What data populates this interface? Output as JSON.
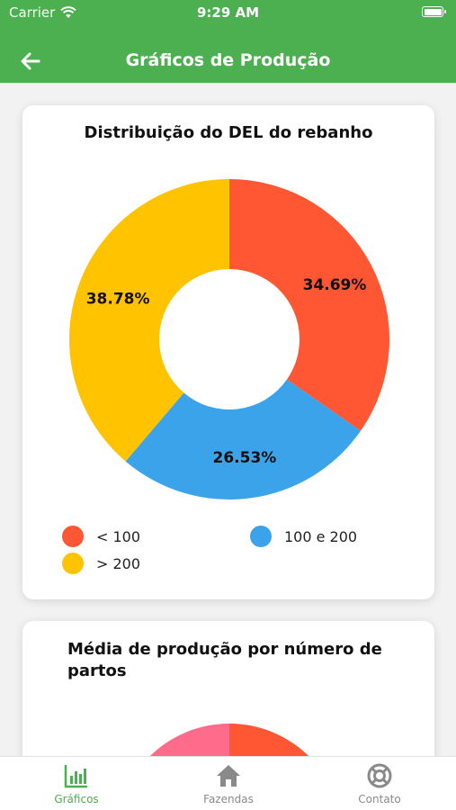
{
  "status_bar": {
    "carrier": "Carrier",
    "time": "9:29 AM"
  },
  "header": {
    "title": "Gráficos de Produção"
  },
  "cards": [
    {
      "title": "Distribuição do DEL do rebanho",
      "chart_data": {
        "type": "pie",
        "categories": [
          "< 100",
          "100 e 200",
          "> 200"
        ],
        "values": [
          34.69,
          26.53,
          38.78
        ],
        "labels": [
          "34.69%",
          "26.53%",
          "38.78%"
        ],
        "colors": [
          "#ff5733",
          "#3aa3ea",
          "#ffc300"
        ],
        "donut": true
      },
      "legend": [
        {
          "label": "< 100",
          "color": "#ff5733"
        },
        {
          "label": "100 e 200",
          "color": "#3aa3ea"
        },
        {
          "label": "> 200",
          "color": "#ffc300"
        }
      ]
    },
    {
      "title": "Média de produção por número de partos",
      "chart_data": {
        "type": "pie",
        "visible_colors": [
          "#ff5733",
          "#ff6b8a"
        ]
      }
    }
  ],
  "bottom_nav": {
    "tabs": [
      {
        "label": "Gráficos",
        "icon": "bar-chart-icon",
        "active": true
      },
      {
        "label": "Fazendas",
        "icon": "home-icon",
        "active": false
      },
      {
        "label": "Contato",
        "icon": "lifebuoy-icon",
        "active": false
      }
    ]
  },
  "colors": {
    "primary": "#4caf50",
    "background": "#f2f2f2"
  }
}
